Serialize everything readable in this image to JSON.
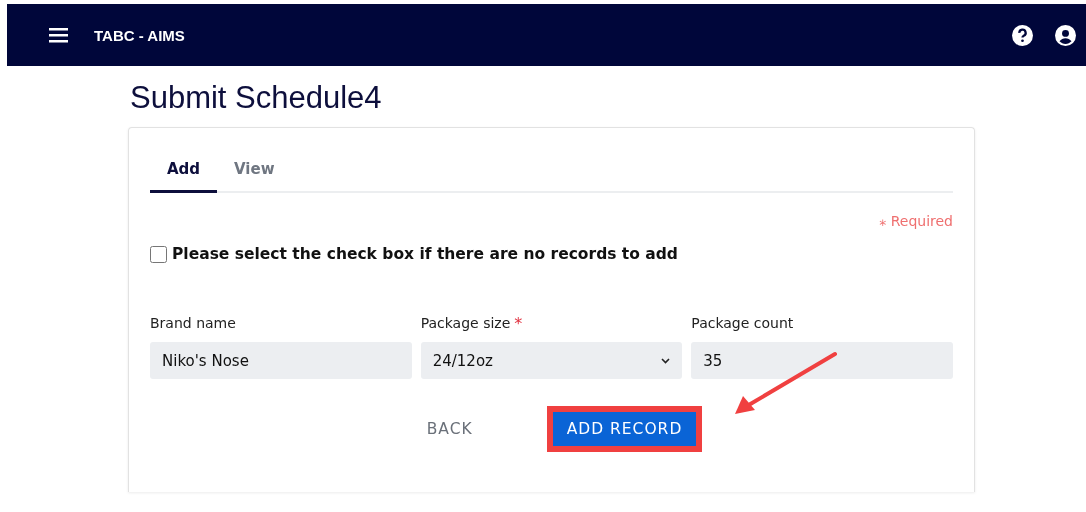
{
  "header": {
    "title": "TABC - AIMS"
  },
  "page_title": "Submit Schedule4",
  "tabs": [
    {
      "label": "Add",
      "selected": true
    },
    {
      "label": "View",
      "selected": false
    }
  ],
  "required_note": "⁎ Required",
  "no_records": {
    "label": "Please select the check box if there are no records to add",
    "checked": false
  },
  "fields": [
    {
      "kind": "text",
      "label": "Brand name",
      "required": false,
      "value": "Niko's Nose"
    },
    {
      "kind": "select",
      "label": "Package size",
      "required": true,
      "value": "24/12oz"
    },
    {
      "kind": "text",
      "label": "Package count",
      "required": false,
      "value": "35"
    }
  ],
  "required_mark": "*",
  "buttons": [
    {
      "kind": "plain",
      "label": "BACK",
      "highlighted": false
    },
    {
      "kind": "primary",
      "label": "ADD RECORD",
      "highlighted": true
    }
  ]
}
